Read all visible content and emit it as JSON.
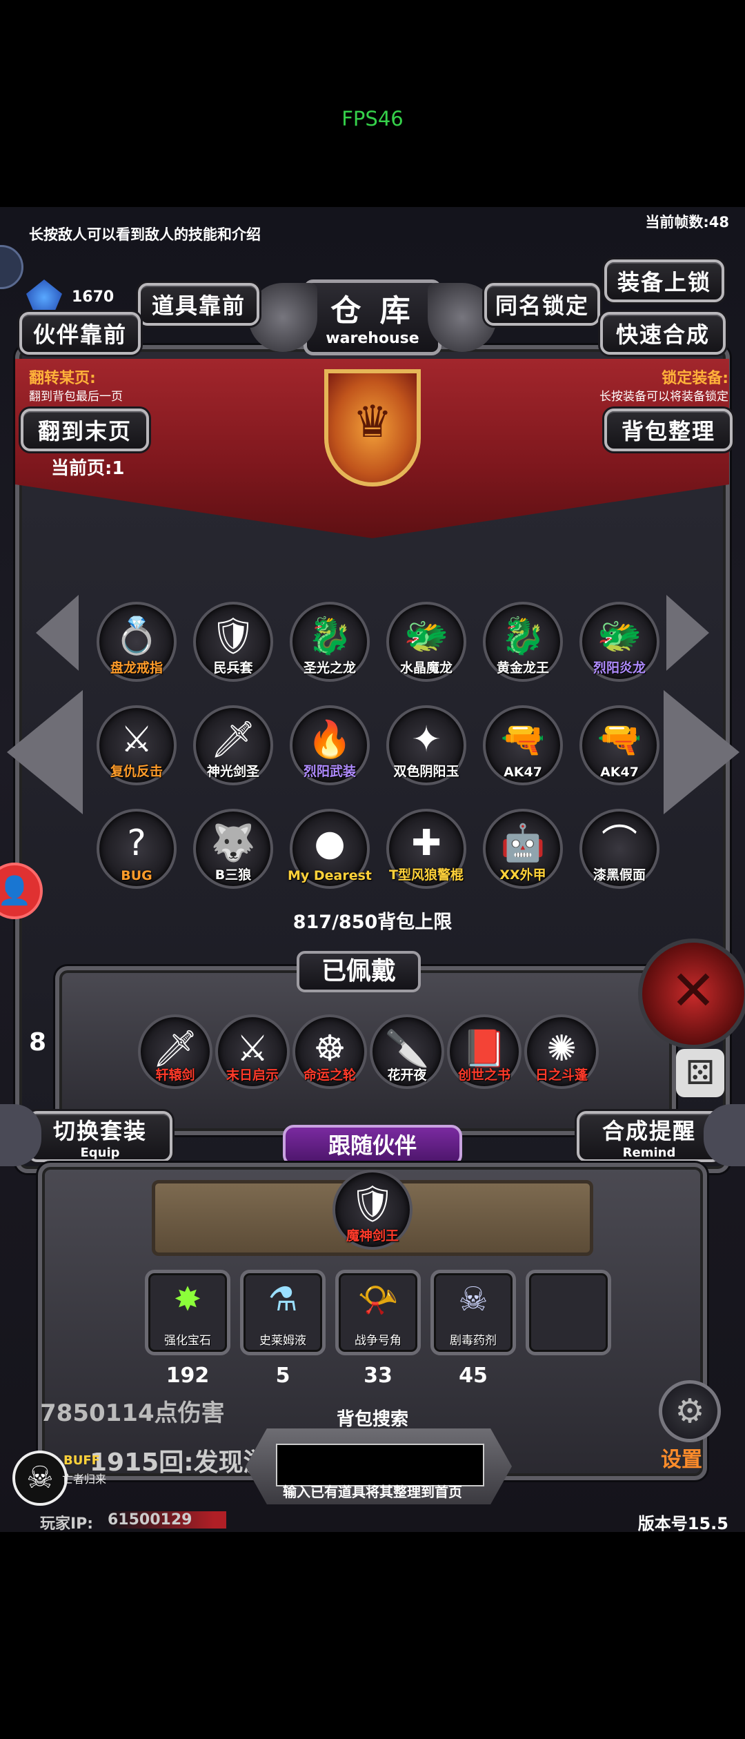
{
  "fps": "FPS46",
  "hud": {
    "long_press_tip": "长按敌人可以看到敌人的技能和介绍",
    "frame_count": "当前帧数:48",
    "gem_count": "1670",
    "damage_text": "7850114点伤害",
    "round_text": "1915回:发现游",
    "player_ip_label": "玩家IP:",
    "player_ip_value": "61500129",
    "version": "版本号15.5",
    "buff_label": "BUFF",
    "buff_sub": "亡者归来",
    "settings": "设置",
    "side_left_num": "8"
  },
  "warehouse": {
    "title": "仓 库",
    "subtitle": "warehouse",
    "buttons": {
      "items_front": "道具靠前",
      "partner_front": "伙伴靠前",
      "same_name_lock": "同名锁定",
      "equip_lock": "装备上锁",
      "quick_craft": "快速合成",
      "to_last_page": "翻到末页",
      "bag_sort": "背包整理"
    },
    "flip_label": "翻转某页:",
    "flip_sub": "翻到背包最后一页",
    "lock_label": "锁定装备:",
    "lock_sub": "长按装备可以将装备锁定",
    "current_page": "当前页:1",
    "items": [
      {
        "name": "盘龙戒指",
        "icon": "ring-icon",
        "glyph": "💍",
        "color": "#ff9c2a"
      },
      {
        "name": "民兵套",
        "icon": "armor-icon",
        "glyph": "🛡",
        "color": "#ffffff"
      },
      {
        "name": "圣光之龙",
        "icon": "dragon-icon",
        "glyph": "🐉",
        "color": "#ffffff"
      },
      {
        "name": "水晶魔龙",
        "icon": "dragon-icon",
        "glyph": "🐲",
        "color": "#ffffff"
      },
      {
        "name": "黄金龙王",
        "icon": "dragon-icon",
        "glyph": "🐉",
        "color": "#ffffff"
      },
      {
        "name": "烈阳炎龙",
        "icon": "dragon-icon",
        "glyph": "🐲",
        "color": "#b08cff"
      },
      {
        "name": "复仇反击",
        "icon": "armor-icon",
        "glyph": "⚔",
        "color": "#ff9c2a"
      },
      {
        "name": "神光剑圣",
        "icon": "knight-icon",
        "glyph": "🗡",
        "color": "#ffffff"
      },
      {
        "name": "烈阳武装",
        "icon": "armor-icon",
        "glyph": "🔥",
        "color": "#b08cff"
      },
      {
        "name": "双色阴阳玉",
        "icon": "gem-icon",
        "glyph": "✦",
        "color": "#ffffff"
      },
      {
        "name": "AK47",
        "icon": "rifle-icon",
        "glyph": "🔫",
        "color": "#ffffff"
      },
      {
        "name": "AK47",
        "icon": "rifle-icon",
        "glyph": "🔫",
        "color": "#ffffff"
      },
      {
        "name": "BUG",
        "icon": "bug-icon",
        "glyph": "?",
        "color": "#ff9c2a"
      },
      {
        "name": "B三狼",
        "icon": "wolf-icon",
        "glyph": "🐺",
        "color": "#ffffff"
      },
      {
        "name": "My Dearest",
        "icon": "orb-icon",
        "glyph": "●",
        "color": "#ffd23a"
      },
      {
        "name": "T型风狼警棍",
        "icon": "baton-icon",
        "glyph": "✚",
        "color": "#ffd23a"
      },
      {
        "name": "XX外甲",
        "icon": "mech-icon",
        "glyph": "🤖",
        "color": "#ffd23a"
      },
      {
        "name": "漆黑假面",
        "icon": "mask-icon",
        "glyph": "⌒",
        "color": "#ffffff"
      }
    ],
    "bag_limit": "817/850背包上限"
  },
  "equipped": {
    "title": "已佩戴",
    "items": [
      {
        "name": "轩辕剑",
        "icon": "sword-icon",
        "glyph": "🗡",
        "color": "#ff3a2a"
      },
      {
        "name": "末日启示",
        "icon": "crossed-swords-icon",
        "glyph": "⚔",
        "color": "#ff3a2a"
      },
      {
        "name": "命运之轮",
        "icon": "wheel-icon",
        "glyph": "☸",
        "color": "#ff3a2a"
      },
      {
        "name": "花开夜",
        "icon": "dagger-icon",
        "glyph": "🔪",
        "color": "#ffffff"
      },
      {
        "name": "创世之书",
        "icon": "book-icon",
        "glyph": "📕",
        "color": "#ff3a2a"
      },
      {
        "name": "日之斗蓬",
        "icon": "cloak-icon",
        "glyph": "✺",
        "color": "#ff3a2a"
      }
    ],
    "switch_set": "切换套装",
    "switch_set_sub": "Equip",
    "craft_remind": "合成提醒",
    "craft_remind_sub": "Remind"
  },
  "partner": {
    "title": "跟随伙伴",
    "name": "魔神剑王",
    "glyph": "🛡"
  },
  "consumables": [
    {
      "name": "强化宝石",
      "count": "192",
      "icon": "green-gem-icon",
      "glyph": "✸",
      "color": "#8cff3a"
    },
    {
      "name": "史莱姆液",
      "count": "5",
      "icon": "flask-icon",
      "glyph": "⚗",
      "color": "#9adfff"
    },
    {
      "name": "战争号角",
      "count": "33",
      "icon": "horn-icon",
      "glyph": "📯",
      "color": "#d28cff"
    },
    {
      "name": "剧毒药剂",
      "count": "45",
      "icon": "potion-icon",
      "glyph": "☠",
      "color": "#cfd7ff"
    }
  ],
  "search": {
    "label": "背包搜索",
    "placeholder": "",
    "hint": "输入已有道具将其整理到首页"
  }
}
